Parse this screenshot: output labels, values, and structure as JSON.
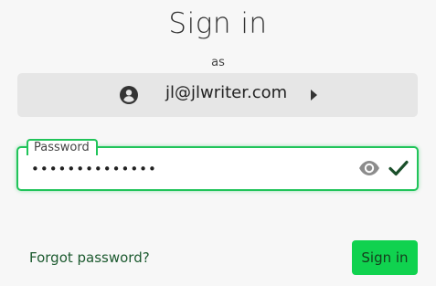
{
  "page": {
    "title": "Sign in",
    "subtitle": "as"
  },
  "account": {
    "email": "jl@jlwriter.com",
    "avatar_icon": "user-circle-icon",
    "caret_icon": "chevron-right-icon"
  },
  "password": {
    "label": "Password",
    "value": "••••••••••••••",
    "show_icon": "eye-icon",
    "valid_icon": "check-icon"
  },
  "actions": {
    "forgot_label": "Forgot password?",
    "signin_label": "Sign in"
  },
  "colors": {
    "accent": "#21c45a",
    "button": "#10d24f",
    "link": "#1c5a2f",
    "account_bg": "#e6e6e6"
  }
}
